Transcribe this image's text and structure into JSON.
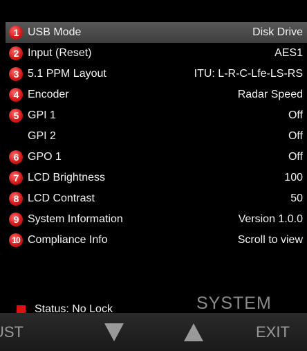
{
  "menu": {
    "items": [
      {
        "badge": "1",
        "label": "USB Mode",
        "value": "Disk Drive"
      },
      {
        "badge": "2",
        "label": "Input (Reset)",
        "value": "AES1"
      },
      {
        "badge": "3",
        "label": "5.1 PPM Layout",
        "value": "ITU: L-R-C-Lfe-LS-RS"
      },
      {
        "badge": "4",
        "label": "Encoder",
        "value": "Radar Speed"
      },
      {
        "badge": "5",
        "label": "GPI 1",
        "value": "Off"
      },
      {
        "badge": "",
        "label": "GPI 2",
        "value": "Off"
      },
      {
        "badge": "6",
        "label": "GPO 1",
        "value": "Off"
      },
      {
        "badge": "7",
        "label": "LCD Brightness",
        "value": "100"
      },
      {
        "badge": "8",
        "label": "LCD Contrast",
        "value": "50"
      },
      {
        "badge": "9",
        "label": "System Information",
        "value": "Version 1.0.0"
      },
      {
        "badge": "10",
        "label": "Compliance Info",
        "value": "Scroll to view"
      }
    ],
    "selected_index": 0
  },
  "status": {
    "text": "Status: No Lock",
    "indicator_color": "#e01010"
  },
  "mode_label": "SYSTEM",
  "softkeys": {
    "left_label": "UST",
    "down_icon": "down-arrow-icon",
    "up_icon": "up-arrow-icon",
    "right_label": "EXIT"
  },
  "colors": {
    "background": "#000000",
    "badge": "#d61a1a",
    "selected_row": "#4a4a4a",
    "softkey_text": "#9a9a9a"
  }
}
